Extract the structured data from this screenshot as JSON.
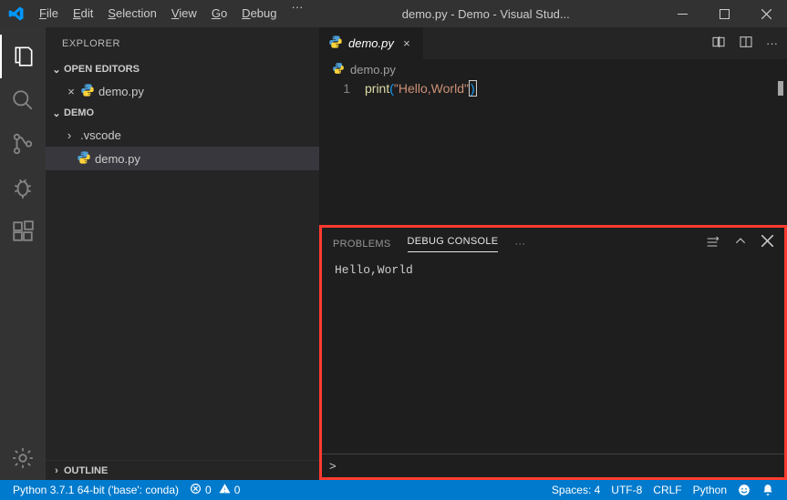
{
  "titlebar": {
    "menu": [
      "File",
      "Edit",
      "Selection",
      "View",
      "Go",
      "Debug"
    ],
    "overflow": "···",
    "title": "demo.py - Demo - Visual Stud..."
  },
  "sidebar": {
    "title": "EXPLORER",
    "openEditors": {
      "label": "OPEN EDITORS",
      "items": [
        {
          "name": "demo.py"
        }
      ]
    },
    "folder": {
      "label": "DEMO",
      "items": [
        {
          "name": ".vscode",
          "type": "folder"
        },
        {
          "name": "demo.py",
          "type": "file"
        }
      ]
    },
    "outline": {
      "label": "OUTLINE"
    }
  },
  "editor": {
    "tab": {
      "name": "demo.py"
    },
    "breadcrumb": "demo.py",
    "lineNumber": "1",
    "code": {
      "fn": "print",
      "str": "\"Hello,World\""
    }
  },
  "panel": {
    "tabs": {
      "problems": "PROBLEMS",
      "debugConsole": "DEBUG CONSOLE",
      "more": "···"
    },
    "output": "Hello,World",
    "prompt": ">"
  },
  "statusbar": {
    "python": "Python 3.7.1 64-bit ('base': conda)",
    "errors": "0",
    "warnings": "0",
    "spaces": "Spaces: 4",
    "encoding": "UTF-8",
    "eol": "CRLF",
    "language": "Python"
  }
}
